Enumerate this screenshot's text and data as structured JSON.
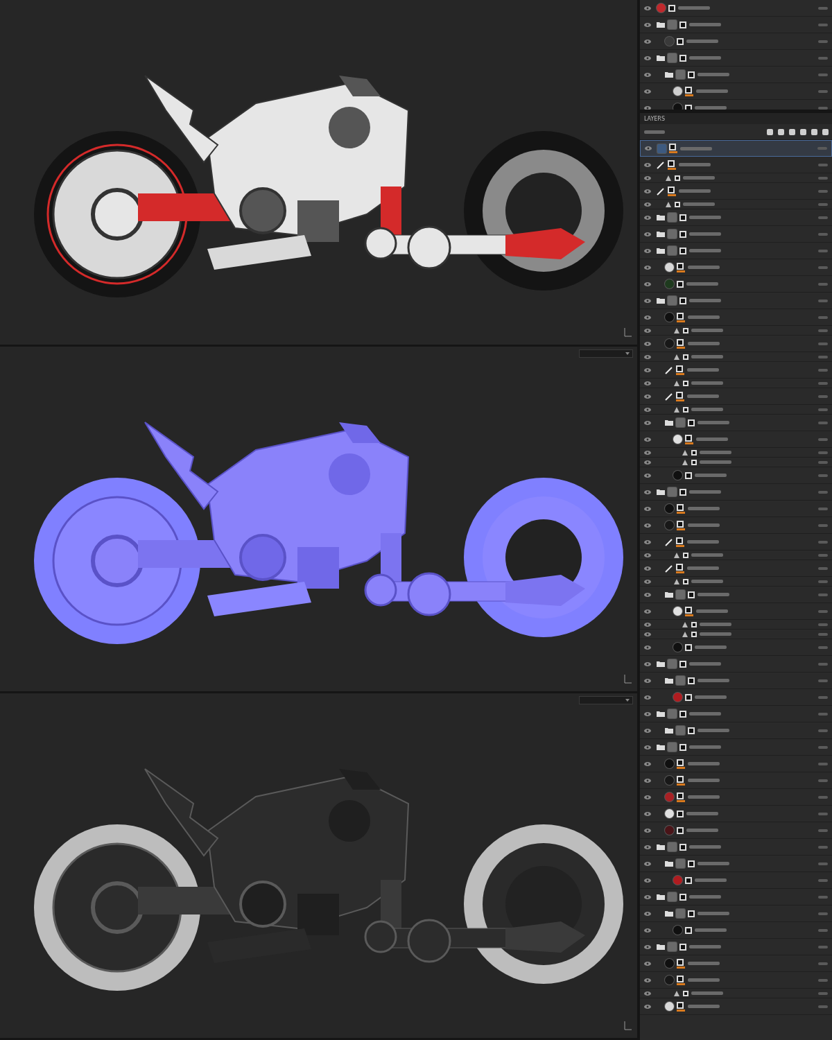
{
  "viewports": [
    {
      "kind": "base",
      "dropdown": false
    },
    {
      "kind": "normal",
      "dropdown": true
    },
    {
      "kind": "roughness",
      "dropdown": true
    }
  ],
  "stack": {
    "rows": [
      {
        "kind": "fill",
        "color": "#c0282c",
        "masked": false,
        "selected": false
      },
      {
        "kind": "folder",
        "color": "#6a6a6a",
        "masked": false,
        "selected": false,
        "children": [
          {
            "kind": "fill",
            "color": "#3a3a3a",
            "masked": false,
            "selected": false
          }
        ]
      },
      {
        "kind": "folder",
        "color": "#6a6a6a",
        "masked": false,
        "selected": false,
        "children": [
          {
            "kind": "folder",
            "color": "#6a6a6a",
            "masked": false,
            "selected": false,
            "children": [
              {
                "kind": "fill",
                "color": "#cfcfcf",
                "masked": true,
                "selected": false
              },
              {
                "kind": "fill",
                "color": "#101010",
                "masked": false,
                "selected": false
              }
            ]
          }
        ]
      }
    ]
  },
  "layers": {
    "title": "LAYERS",
    "rows": [
      {
        "kind": "paint",
        "color": "#3d5a80",
        "masked": true,
        "selected": true
      },
      {
        "kind": "brush",
        "masked": true,
        "selected": false,
        "children": [
          {
            "kind": "filter",
            "masked": false,
            "selected": false
          }
        ]
      },
      {
        "kind": "brush",
        "masked": true,
        "selected": false,
        "children": [
          {
            "kind": "filter",
            "masked": false,
            "selected": false
          }
        ]
      },
      {
        "kind": "folder",
        "color": "#6a6a6a",
        "masked": false,
        "selected": false
      },
      {
        "kind": "folder",
        "color": "#6a6a6a",
        "masked": false,
        "selected": false
      },
      {
        "kind": "folder",
        "color": "#6a6a6a",
        "masked": false,
        "selected": false,
        "children": [
          {
            "kind": "fill",
            "color": "#d8d8d8",
            "masked": true,
            "selected": false
          },
          {
            "kind": "fill",
            "color": "#1e3a1e",
            "masked": false,
            "selected": false
          }
        ]
      },
      {
        "kind": "folder",
        "color": "#6a6a6a",
        "masked": false,
        "selected": false,
        "children": [
          {
            "kind": "fill",
            "color": "#101010",
            "masked": true,
            "selected": false,
            "children": [
              {
                "kind": "filter",
                "masked": false,
                "selected": false
              }
            ]
          },
          {
            "kind": "fill",
            "color": "#181818",
            "masked": true,
            "selected": false,
            "children": [
              {
                "kind": "filter",
                "masked": false,
                "selected": false
              }
            ]
          },
          {
            "kind": "brush",
            "masked": true,
            "selected": false,
            "children": [
              {
                "kind": "filter",
                "masked": false,
                "selected": false
              }
            ]
          },
          {
            "kind": "brush",
            "masked": true,
            "selected": false,
            "children": [
              {
                "kind": "filter",
                "masked": false,
                "selected": false
              }
            ]
          },
          {
            "kind": "folder",
            "color": "#6a6a6a",
            "masked": false,
            "selected": false,
            "children": [
              {
                "kind": "fill",
                "color": "#e0e0e0",
                "masked": true,
                "selected": false,
                "children": [
                  {
                    "kind": "filter",
                    "masked": false,
                    "selected": false
                  },
                  {
                    "kind": "filter",
                    "masked": false,
                    "selected": false
                  }
                ]
              },
              {
                "kind": "fill",
                "color": "#101010",
                "masked": false,
                "selected": false
              }
            ]
          }
        ]
      },
      {
        "kind": "folder",
        "color": "#6a6a6a",
        "masked": false,
        "selected": false,
        "children": [
          {
            "kind": "fill",
            "color": "#101010",
            "masked": true,
            "selected": false
          },
          {
            "kind": "fill",
            "color": "#181818",
            "masked": true,
            "selected": false
          },
          {
            "kind": "brush",
            "masked": true,
            "selected": false,
            "children": [
              {
                "kind": "filter",
                "masked": false,
                "selected": false
              }
            ]
          },
          {
            "kind": "brush",
            "masked": true,
            "selected": false,
            "children": [
              {
                "kind": "filter",
                "masked": false,
                "selected": false
              }
            ]
          },
          {
            "kind": "folder",
            "color": "#6a6a6a",
            "masked": false,
            "selected": false,
            "children": [
              {
                "kind": "fill",
                "color": "#e0e0e0",
                "masked": true,
                "selected": false,
                "children": [
                  {
                    "kind": "filter",
                    "masked": false,
                    "selected": false
                  },
                  {
                    "kind": "filter",
                    "masked": false,
                    "selected": false
                  }
                ]
              },
              {
                "kind": "fill",
                "color": "#101010",
                "masked": false,
                "selected": false
              }
            ]
          }
        ]
      },
      {
        "kind": "folder",
        "color": "#6a6a6a",
        "masked": false,
        "selected": false,
        "children": [
          {
            "kind": "folder",
            "color": "#6a6a6a",
            "masked": false,
            "selected": false,
            "children": [
              {
                "kind": "fill",
                "color": "#b01c20",
                "masked": false,
                "selected": false
              }
            ]
          }
        ]
      },
      {
        "kind": "folder",
        "color": "#6a6a6a",
        "masked": false,
        "selected": false,
        "children": [
          {
            "kind": "folder",
            "color": "#6a6a6a",
            "masked": false,
            "selected": false
          }
        ]
      },
      {
        "kind": "folder",
        "color": "#6a6a6a",
        "masked": false,
        "selected": false,
        "children": [
          {
            "kind": "fill",
            "color": "#101010",
            "masked": true,
            "selected": false
          },
          {
            "kind": "fill",
            "color": "#181818",
            "masked": true,
            "selected": false
          },
          {
            "kind": "fill",
            "color": "#a82024",
            "masked": true,
            "selected": false
          },
          {
            "kind": "fill",
            "color": "#e0e0e0",
            "masked": false,
            "selected": false
          },
          {
            "kind": "fill",
            "color": "#4a1418",
            "masked": false,
            "selected": false
          }
        ]
      },
      {
        "kind": "folder",
        "color": "#6a6a6a",
        "masked": false,
        "selected": false,
        "children": [
          {
            "kind": "folder",
            "color": "#6a6a6a",
            "masked": false,
            "selected": false,
            "children": [
              {
                "kind": "fill",
                "color": "#b01c20",
                "masked": false,
                "selected": false
              }
            ]
          }
        ]
      },
      {
        "kind": "folder",
        "color": "#6a6a6a",
        "masked": false,
        "selected": false,
        "children": [
          {
            "kind": "folder",
            "color": "#6a6a6a",
            "masked": false,
            "selected": false,
            "children": [
              {
                "kind": "fill",
                "color": "#101010",
                "masked": false,
                "selected": false
              }
            ]
          }
        ]
      },
      {
        "kind": "folder",
        "color": "#6a6a6a",
        "masked": false,
        "selected": false,
        "children": [
          {
            "kind": "fill",
            "color": "#101010",
            "masked": true,
            "selected": false
          },
          {
            "kind": "fill",
            "color": "#181818",
            "masked": true,
            "selected": false,
            "children": [
              {
                "kind": "filter",
                "masked": false,
                "selected": false
              }
            ]
          },
          {
            "kind": "fill",
            "color": "#d8d8d8",
            "masked": true,
            "selected": false
          }
        ]
      }
    ]
  }
}
